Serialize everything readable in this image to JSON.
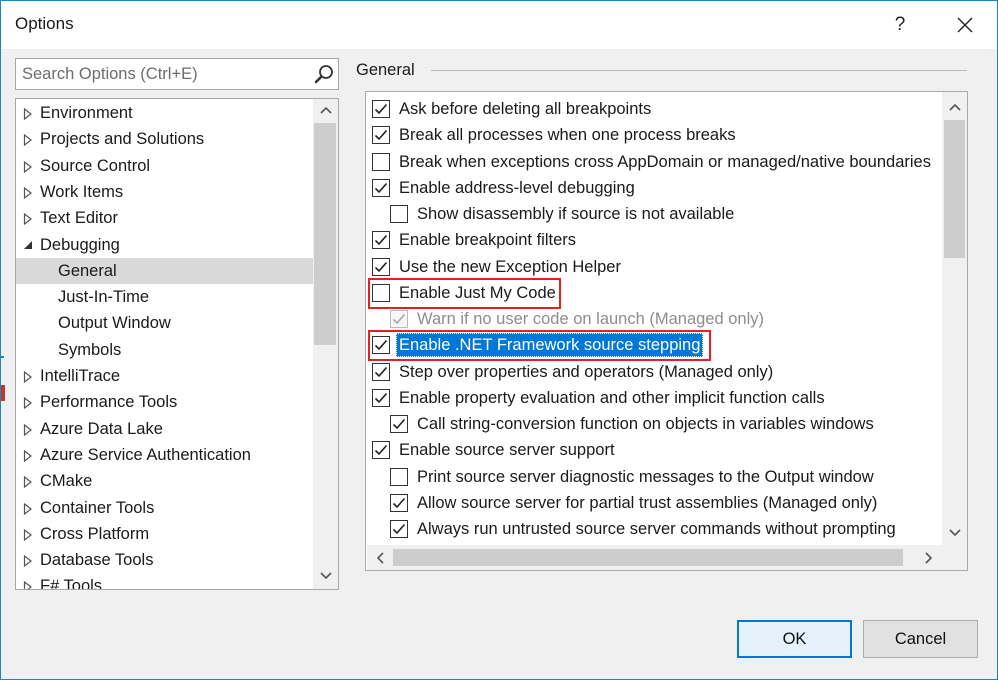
{
  "window": {
    "title": "Options",
    "help_label": "?"
  },
  "search": {
    "placeholder": "Search Options (Ctrl+E)",
    "value": ""
  },
  "tree": {
    "items": [
      {
        "label": "Environment",
        "level": 0,
        "state": "collapsed"
      },
      {
        "label": "Projects and Solutions",
        "level": 0,
        "state": "collapsed"
      },
      {
        "label": "Source Control",
        "level": 0,
        "state": "collapsed"
      },
      {
        "label": "Work Items",
        "level": 0,
        "state": "collapsed"
      },
      {
        "label": "Text Editor",
        "level": 0,
        "state": "collapsed"
      },
      {
        "label": "Debugging",
        "level": 0,
        "state": "expanded"
      },
      {
        "label": "General",
        "level": 1,
        "state": "leaf",
        "selected": true
      },
      {
        "label": "Just-In-Time",
        "level": 1,
        "state": "leaf"
      },
      {
        "label": "Output Window",
        "level": 1,
        "state": "leaf"
      },
      {
        "label": "Symbols",
        "level": 1,
        "state": "leaf"
      },
      {
        "label": "IntelliTrace",
        "level": 0,
        "state": "collapsed"
      },
      {
        "label": "Performance Tools",
        "level": 0,
        "state": "collapsed"
      },
      {
        "label": "Azure Data Lake",
        "level": 0,
        "state": "collapsed"
      },
      {
        "label": "Azure Service Authentication",
        "level": 0,
        "state": "collapsed"
      },
      {
        "label": "CMake",
        "level": 0,
        "state": "collapsed"
      },
      {
        "label": "Container Tools",
        "level": 0,
        "state": "collapsed"
      },
      {
        "label": "Cross Platform",
        "level": 0,
        "state": "collapsed"
      },
      {
        "label": "Database Tools",
        "level": 0,
        "state": "collapsed"
      },
      {
        "label": "F# Tools",
        "level": 0,
        "state": "collapsed"
      }
    ]
  },
  "general": {
    "title": "General",
    "options": [
      {
        "label": "Ask before deleting all breakpoints",
        "checked": true,
        "indent": 0
      },
      {
        "label": "Break all processes when one process breaks",
        "checked": true,
        "indent": 0
      },
      {
        "label": "Break when exceptions cross AppDomain or managed/native boundaries",
        "checked": false,
        "indent": 0
      },
      {
        "label": "Enable address-level debugging",
        "checked": true,
        "indent": 0
      },
      {
        "label": "Show disassembly if source is not available",
        "checked": false,
        "indent": 1
      },
      {
        "label": "Enable breakpoint filters",
        "checked": true,
        "indent": 0
      },
      {
        "label": "Use the new Exception Helper",
        "checked": true,
        "indent": 0
      },
      {
        "label": "Enable Just My Code",
        "checked": false,
        "indent": 0,
        "boxed": true
      },
      {
        "label": "Warn if no user code on launch (Managed only)",
        "checked": true,
        "indent": 1,
        "disabled": true
      },
      {
        "label": "Enable .NET Framework source stepping",
        "checked": true,
        "indent": 0,
        "boxed": true,
        "highlight": true
      },
      {
        "label": "Step over properties and operators (Managed only)",
        "checked": true,
        "indent": 0
      },
      {
        "label": "Enable property evaluation and other implicit function calls",
        "checked": true,
        "indent": 0
      },
      {
        "label": "Call string-conversion function on objects in variables windows",
        "checked": true,
        "indent": 1
      },
      {
        "label": "Enable source server support",
        "checked": true,
        "indent": 0
      },
      {
        "label": "Print source server diagnostic messages to the Output window",
        "checked": false,
        "indent": 1
      },
      {
        "label": "Allow source server for partial trust assemblies (Managed only)",
        "checked": true,
        "indent": 1
      },
      {
        "label": "Always run untrusted source server commands without prompting",
        "checked": true,
        "indent": 1
      }
    ]
  },
  "buttons": {
    "ok": "OK",
    "cancel": "Cancel"
  },
  "colors": {
    "accent": "#0078d7",
    "annotation_red": "#e02222",
    "window_border": "#1a88b8"
  }
}
